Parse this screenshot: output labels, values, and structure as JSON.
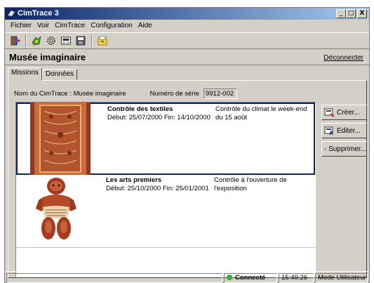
{
  "window": {
    "title": "CimTrace 3",
    "controls": [
      "_",
      "□",
      "X"
    ]
  },
  "menu": [
    "Fichier",
    "Voir",
    "CimTrace",
    "Configuration",
    "Aide"
  ],
  "toolbar": {
    "buttons": [
      "door-exit-icon",
      "mission-icon",
      "settings-gear-icon",
      "device-icon",
      "save-icon",
      "archive-icon"
    ]
  },
  "header": {
    "museum": "Musée imaginaire",
    "disconnect": "Déconnecter"
  },
  "tabs": [
    "Missions",
    "Données"
  ],
  "info": {
    "name_label": "Nom du CimTrace : Musée imaginaire",
    "serial_label": "Numéro de série",
    "serial_value": "9912-002"
  },
  "missions": [
    {
      "name": "Contrôle des textiles",
      "dates": "Début: 25/07/2000   Fin: 14/10/2000",
      "desc": "Contrôle du climat le week-end du 15 août"
    },
    {
      "name": "Les arts premiers",
      "dates": "Début: 25/10/2000   Fin: 25/01/2001",
      "desc": "Contrôle à l'ouverture de l'exposition"
    }
  ],
  "actions": {
    "create": "Créer...",
    "edit": "Editer...",
    "delete": "Supprimer..."
  },
  "status": {
    "connection": "Connecté",
    "time": "15:49:26",
    "mode": "Mode Utilisateur"
  },
  "colors": {
    "titlebar": "#0a246a",
    "selection": "#0a246a",
    "connected": "#2cb52c"
  }
}
